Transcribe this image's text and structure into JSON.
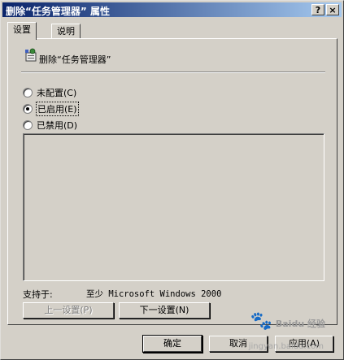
{
  "window": {
    "title": "删除“任务管理器” 属性",
    "help_button": "?",
    "close_button": "×"
  },
  "tabs": [
    {
      "label": "设置",
      "active": true
    },
    {
      "label": "说明",
      "active": false
    }
  ],
  "policy": {
    "icon": "group-policy-setting-icon",
    "name": "删除“任务管理器”"
  },
  "options": [
    {
      "label": "未配置(C)",
      "checked": false
    },
    {
      "label": "已启用(E)",
      "checked": true
    },
    {
      "label": "已禁用(D)",
      "checked": false
    }
  ],
  "support": {
    "label": "支持于:",
    "value": "至少 Microsoft Windows 2000"
  },
  "nav": {
    "prev_label": "上一设置(P)",
    "next_label": "下一设置(N)"
  },
  "footer": {
    "ok_label": "确定",
    "cancel_label": "取消",
    "apply_label": "应用(A)"
  },
  "watermark": {
    "brand": "Baidu 经验",
    "url": "jingyan.baidu.com"
  },
  "colors": {
    "title_gradient_start": "#0a246a",
    "title_gradient_end": "#a6caf0",
    "dialog_face": "#d4d0c8"
  }
}
